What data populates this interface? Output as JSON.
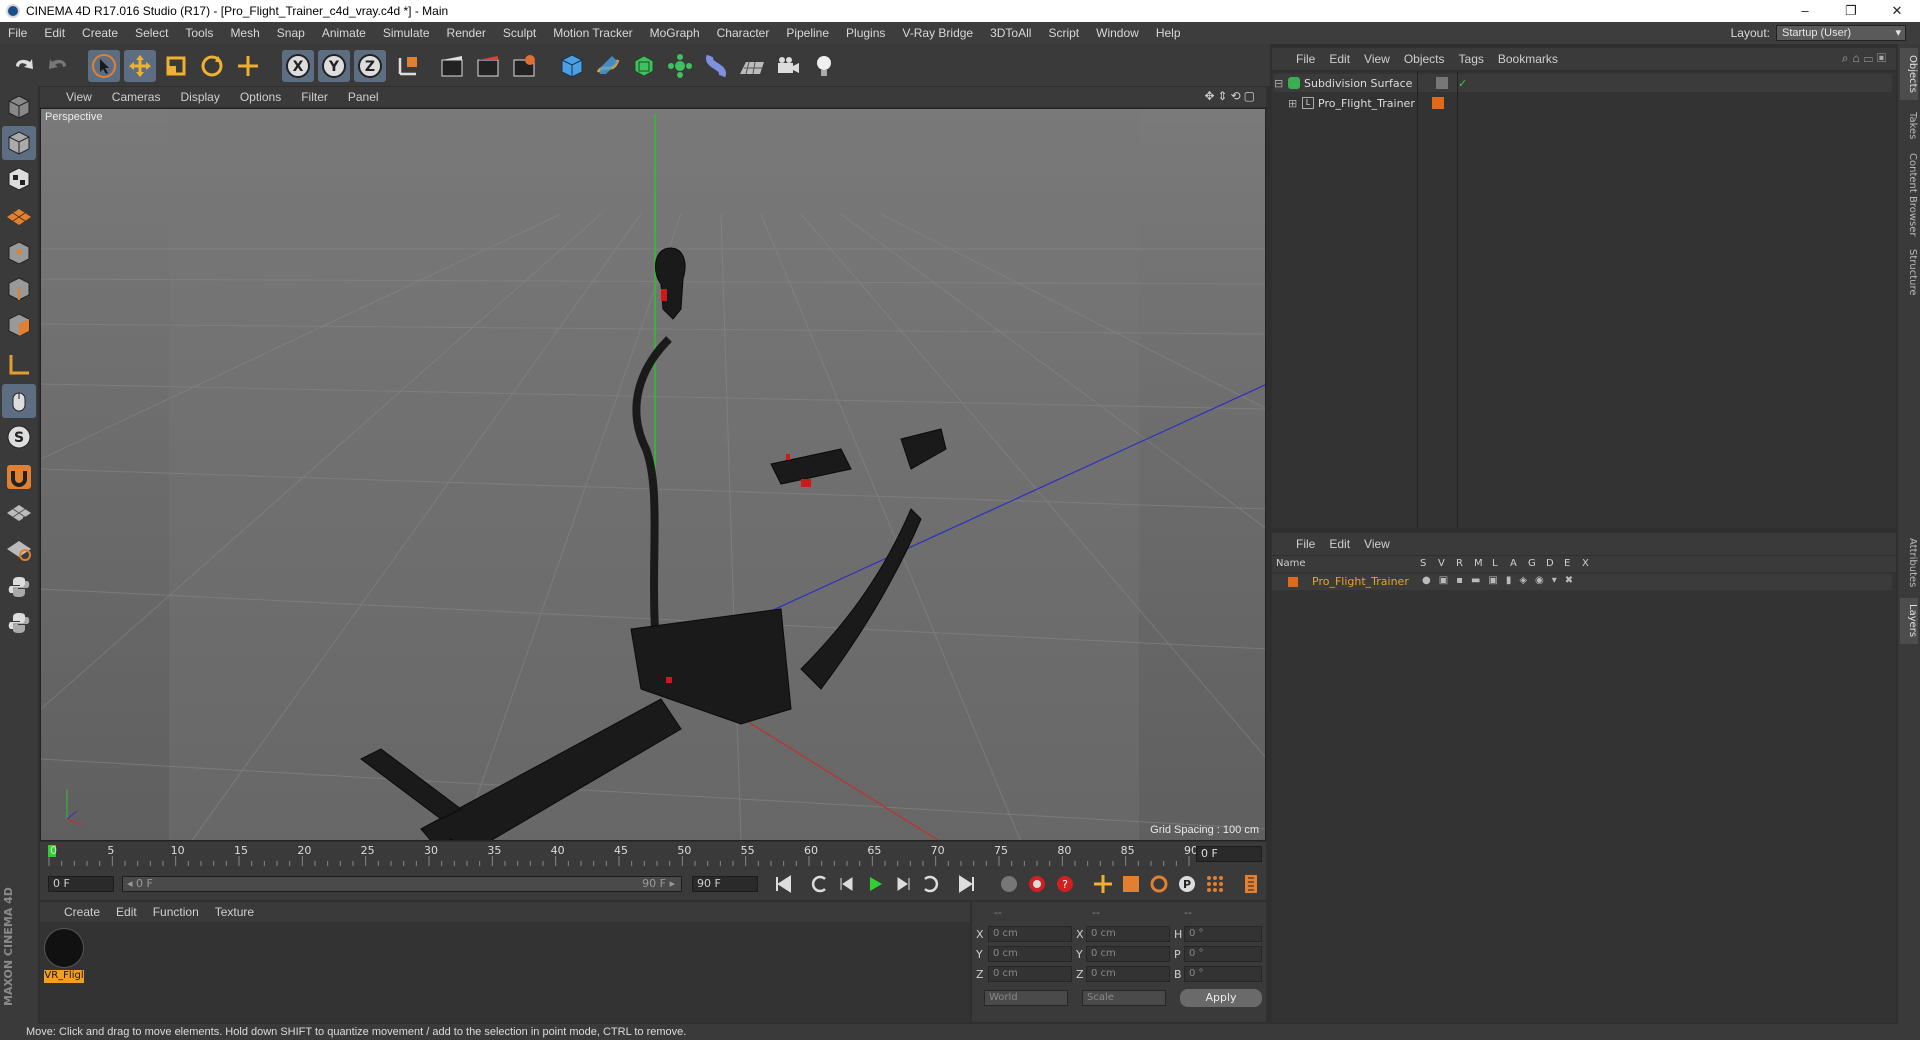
{
  "window": {
    "title": "CINEMA 4D R17.016 Studio (R17) - [Pro_Flight_Trainer_c4d_vray.c4d *] - Main",
    "minimize": "–",
    "restore": "❐",
    "close": "✕"
  },
  "menu": [
    "File",
    "Edit",
    "Create",
    "Select",
    "Tools",
    "Mesh",
    "Snap",
    "Animate",
    "Simulate",
    "Render",
    "Sculpt",
    "Motion Tracker",
    "MoGraph",
    "Character",
    "Pipeline",
    "Plugins",
    "V-Ray Bridge",
    "3DToAll",
    "Script",
    "Window",
    "Help"
  ],
  "layout": {
    "label": "Layout:",
    "value": "Startup (User)"
  },
  "toolbar_icons": [
    "undo-icon",
    "redo-icon",
    "select-arrow-icon",
    "move-icon",
    "scale-icon",
    "rotate-icon",
    "live-select-icon",
    "x-axis-icon",
    "y-axis-icon",
    "z-axis-icon",
    "coordinate-system-icon",
    "render-view-icon",
    "render-picture-viewer-icon",
    "render-settings-icon",
    "cube-icon",
    "pen-icon",
    "subdivision-icon",
    "array-icon",
    "deformer-icon",
    "floor-icon",
    "camera-icon",
    "light-icon"
  ],
  "viewport": {
    "menu": [
      "View",
      "Cameras",
      "Display",
      "Options",
      "Filter",
      "Panel"
    ],
    "label": "Perspective",
    "grid_spacing": "Grid Spacing : 100 cm"
  },
  "timeline": {
    "ticks": [
      "0",
      "5",
      "10",
      "15",
      "20",
      "25",
      "30",
      "35",
      "40",
      "45",
      "50",
      "55",
      "60",
      "65",
      "70",
      "75",
      "80",
      "85",
      "90"
    ],
    "current_frame": "0 F",
    "start_field": "0 F",
    "range_start": "◂ 0 F",
    "range_end": "90 F ▸",
    "end_field": "90 F"
  },
  "material_manager": {
    "menu": [
      "Create",
      "Edit",
      "Function",
      "Texture"
    ],
    "materials": [
      {
        "name": "VR_Fligl"
      }
    ]
  },
  "coordinates": {
    "header": [
      "--",
      "--",
      "--"
    ],
    "rows": [
      {
        "l1": "X",
        "v1": "0 cm",
        "l2": "X",
        "v2": "0 cm",
        "l3": "H",
        "v3": "0 °"
      },
      {
        "l1": "Y",
        "v1": "0 cm",
        "l2": "Y",
        "v2": "0 cm",
        "l3": "P",
        "v3": "0 °"
      },
      {
        "l1": "Z",
        "v1": "0 cm",
        "l2": "Z",
        "v2": "0 cm",
        "l3": "B",
        "v3": "0 °"
      }
    ],
    "world": "World",
    "scale": "Scale",
    "apply": "Apply"
  },
  "object_manager": {
    "menu": [
      "File",
      "Edit",
      "View",
      "Objects",
      "Tags",
      "Bookmarks"
    ],
    "objects": [
      {
        "name": "Subdivision Surface"
      },
      {
        "name": "Pro_Flight_Trainer"
      }
    ]
  },
  "layer_manager": {
    "menu": [
      "File",
      "Edit",
      "View"
    ],
    "columns": [
      "Name",
      "S",
      "V",
      "R",
      "M",
      "L",
      "A",
      "G",
      "D",
      "E",
      "X"
    ],
    "layers": [
      {
        "name": "Pro_Flight_Trainer",
        "color": "#e06a1a"
      }
    ]
  },
  "right_tabs": [
    "Objects",
    "Takes",
    "Content Browser",
    "Structure",
    "Attributes",
    "Layers"
  ],
  "brand": "MAXON CINEMA 4D",
  "status": "Move: Click and drag to move elements. Hold down SHIFT to quantize movement / add to the selection in point mode, CTRL to remove."
}
